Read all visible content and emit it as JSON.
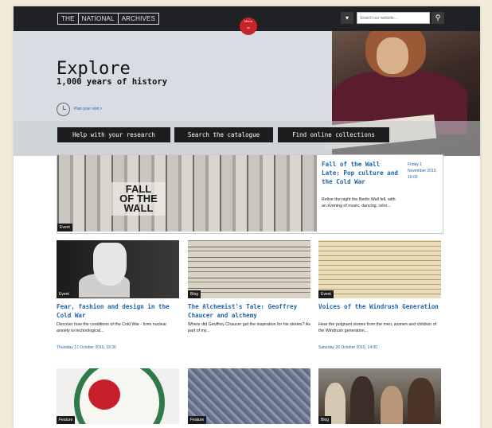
{
  "header": {
    "logo_words": [
      "THE",
      "NATIONAL",
      "ARCHIVES"
    ],
    "menu_label": "Menu",
    "search_placeholder": "Search our website..."
  },
  "hero": {
    "title": "Explore",
    "subtitle": "1,000 years of history",
    "plan_link": "Plan your visit >"
  },
  "nav": [
    {
      "label": "Help with your research"
    },
    {
      "label": "Search the catalogue"
    },
    {
      "label": "Find online collections"
    }
  ],
  "featured": {
    "image_text_line1": "FALL",
    "image_text_line2": "OF THE",
    "image_text_line3": "WALL",
    "tag": "Event",
    "title": "Fall of the Wall Late: Pop culture and the Cold War",
    "description": "Relive the night the Berlin Wall fell, with an evening of music, dancing, retro...",
    "date": "Friday 1 November 2019, 19:00"
  },
  "cards": [
    {
      "tag": "Event",
      "title": "Fear, fashion and design in the Cold War",
      "description": "Discover how the conditions of the Cold War - from nuclear anxiety to technological...",
      "date": "Thursday 17 October 2019, 19:30"
    },
    {
      "tag": "Blog",
      "title": "The Alchemist's Tale: Geoffrey Chaucer and alchemy",
      "description": "Where did Geoffrey Chaucer get the inspiration for his stories? As part of my...",
      "date": ""
    },
    {
      "tag": "Event",
      "title": "Voices of the Windrush Generation",
      "description": "Hear the poignant stories from the men, women and children of the Windrush generation...",
      "date": "Saturday 26 October 2019, 14:00"
    }
  ],
  "bottom_cards": [
    {
      "tag": "Feature"
    },
    {
      "tag": "Feature"
    },
    {
      "tag": "Blog"
    }
  ],
  "colors": {
    "header_bg": "#202124",
    "link_blue": "#1e63a8",
    "menu_red": "#c8232b"
  }
}
